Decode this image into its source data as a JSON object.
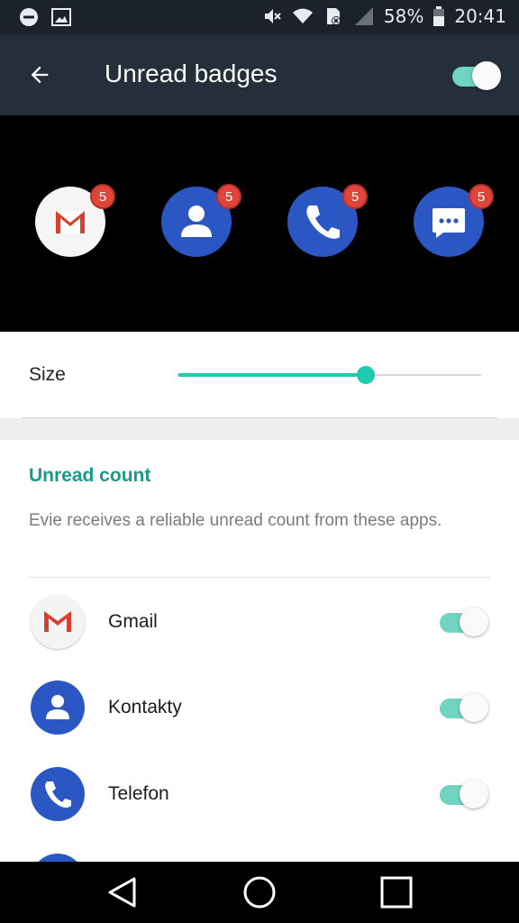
{
  "status_bar": {
    "battery_percent": "58%",
    "time": "20:41",
    "icons_left": [
      "do-not-disturb-icon",
      "image-icon"
    ],
    "icons_right": [
      "mute-icon",
      "wifi-icon",
      "sim-error-icon",
      "signal-icon",
      "battery-icon"
    ]
  },
  "app_bar": {
    "title": "Unread badges",
    "back_icon": "arrow-back-icon",
    "master_toggle": true
  },
  "preview": {
    "icons": [
      {
        "app": "gmail",
        "icon": "gmail-icon",
        "badge": "5"
      },
      {
        "app": "contacts",
        "icon": "contacts-icon",
        "badge": "5"
      },
      {
        "app": "phone",
        "icon": "phone-icon",
        "badge": "5"
      },
      {
        "app": "messages",
        "icon": "messages-icon",
        "badge": "5"
      }
    ]
  },
  "size": {
    "label": "Size",
    "value_fraction": 0.62
  },
  "unread_count": {
    "title": "Unread count",
    "description": "Evie receives a reliable unread count from these apps.",
    "apps": [
      {
        "label": "Gmail",
        "icon": "gmail-icon",
        "enabled": true
      },
      {
        "label": "Kontakty",
        "icon": "contacts-icon",
        "enabled": true
      },
      {
        "label": "Telefon",
        "icon": "phone-icon",
        "enabled": true
      }
    ]
  },
  "nav_bar": {
    "buttons": [
      "back-nav-icon",
      "home-nav-icon",
      "recents-nav-icon"
    ]
  },
  "colors": {
    "accent": "#1fcab0",
    "section_title": "#189b8c",
    "app_bar": "#252f3c",
    "status_bar": "#1b222c",
    "badge": "#e0453a",
    "icon_blue": "#2b57c5"
  }
}
